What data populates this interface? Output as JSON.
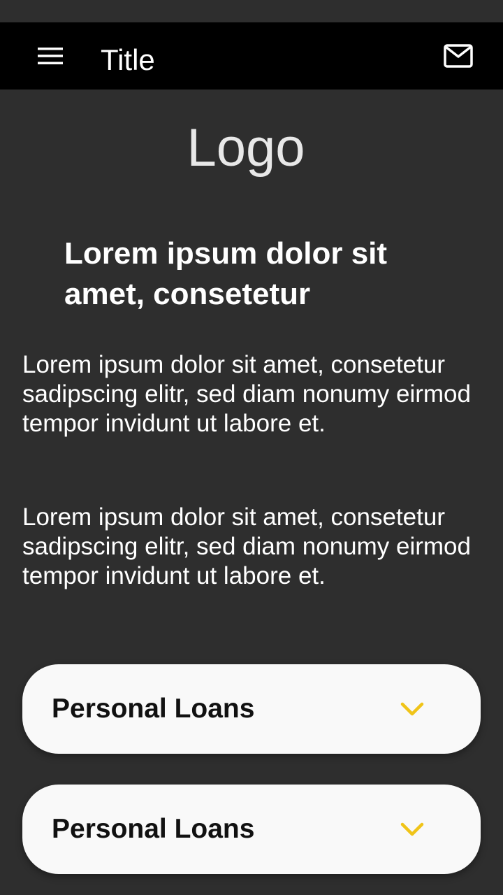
{
  "app_bar": {
    "title": "Title",
    "menu_icon": "hamburger-menu-icon",
    "mail_icon": "mail-icon"
  },
  "logo_text": "Logo",
  "headline": "Lorem ipsum dolor sit amet, consetetur",
  "paragraphs": [
    "Lorem ipsum dolor sit amet, consetetur sadipscing elitr, sed diam nonumy eirmod tempor invidunt ut labore et.",
    "Lorem ipsum dolor sit amet, consetetur sadipscing elitr, sed diam nonumy eirmod tempor invidunt ut labore et."
  ],
  "accordions": [
    {
      "label": "Personal Loans",
      "icon": "chevron-down-icon"
    },
    {
      "label": "Personal Loans",
      "icon": "chevron-down-icon"
    }
  ],
  "colors": {
    "background": "#2e2e2e",
    "app_bar": "#000000",
    "accent": "#f0c419",
    "card": "#f9f9f9"
  }
}
